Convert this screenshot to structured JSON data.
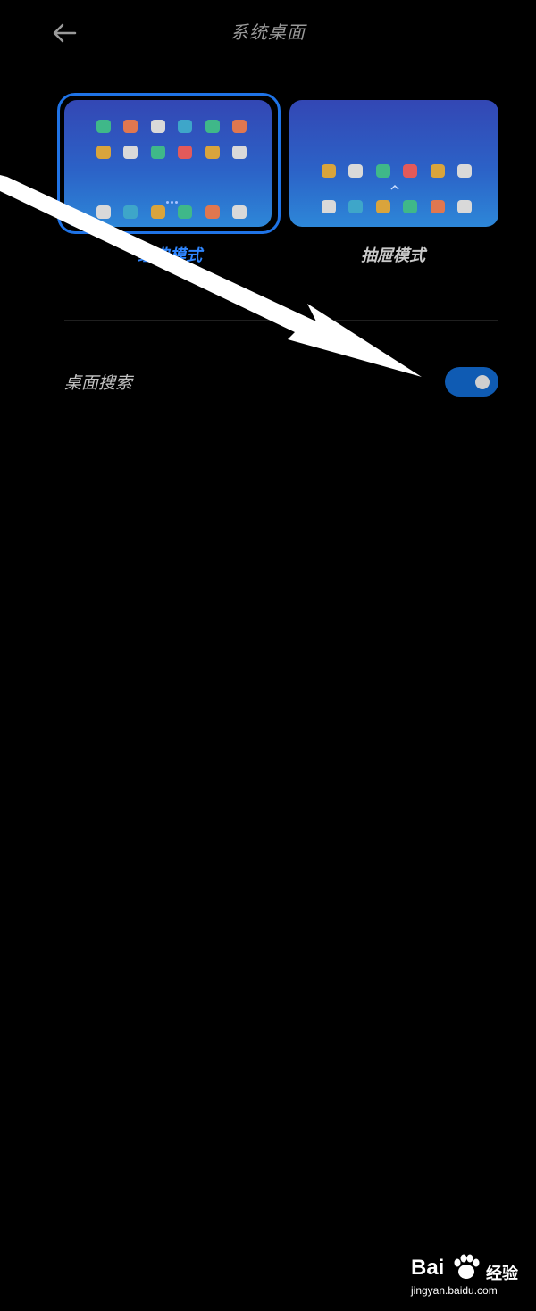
{
  "header": {
    "title": "系统桌面"
  },
  "modes": [
    {
      "label": "经典模式",
      "selected": true,
      "rows": [
        [
          "#3fb889",
          "#e0774f",
          "#d9d9d9",
          "#3ea6c9",
          "#3fb889",
          "#e0774f"
        ],
        [
          "#d9a43c",
          "#d9d9d9",
          "#3fb889",
          "#e35a5a",
          "#d9a43c",
          "#d9d9d9"
        ],
        [
          "#d9d9d9",
          "#3ea6c9",
          "#d9a43c",
          "#3fb889",
          "#e0774f",
          "#d9d9d9"
        ]
      ]
    },
    {
      "label": "抽屉模式",
      "selected": false,
      "rows": [
        [
          "#d9a43c",
          "#d9d9d9",
          "#3fb889",
          "#e35a5a",
          "#d9a43c",
          "#d9d9d9"
        ],
        [
          "#d9d9d9",
          "#3ea6c9",
          "#d9a43c",
          "#3fb889",
          "#e0774f",
          "#d9d9d9"
        ]
      ]
    }
  ],
  "settings": [
    {
      "label": "桌面搜索",
      "enabled": true
    }
  ],
  "watermark": {
    "brand": "Bai",
    "name": "经验",
    "url": "jingyan.baidu.com"
  },
  "colors": {
    "accent": "#2f86ff",
    "toggle_on": "#0f5bb3",
    "background": "#000000"
  }
}
